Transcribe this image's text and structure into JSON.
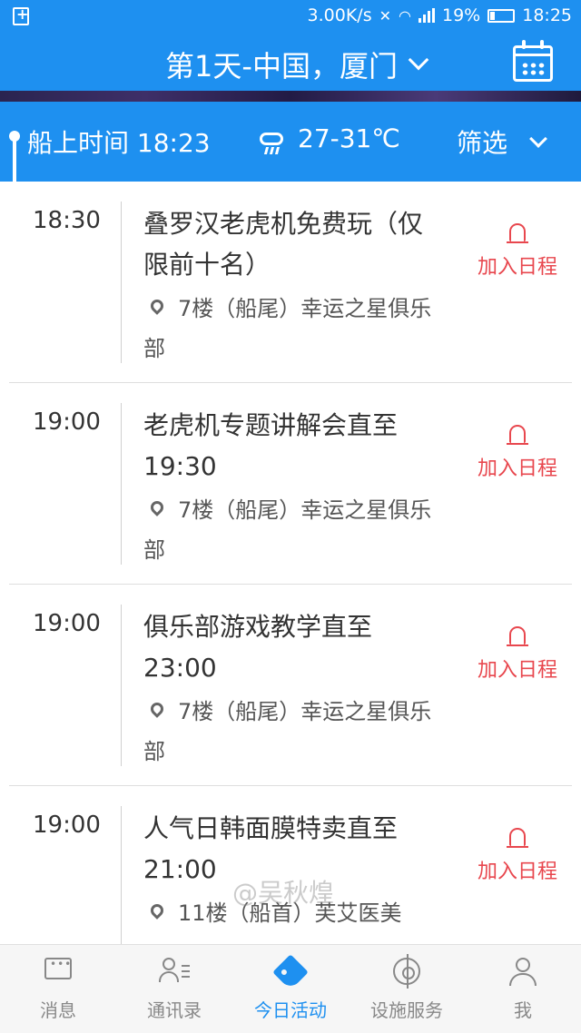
{
  "status": {
    "speed": "3.00K/s",
    "battery": "19%",
    "clock": "18:25"
  },
  "header": {
    "title": "第1天-中国，厦门"
  },
  "infobar": {
    "ship_time": "船上时间 18:23",
    "temperature": "27-31℃",
    "filter_label": "筛选"
  },
  "events": [
    {
      "time": "18:30",
      "title": "叠罗汉老虎机免费玩（仅限前十名）",
      "location": "7楼（船尾）幸运之星俱乐部",
      "action": "加入日程"
    },
    {
      "time": "19:00",
      "title": "老虎机专题讲解会直至19:30",
      "location": "7楼（船尾）幸运之星俱乐部",
      "action": "加入日程"
    },
    {
      "time": "19:00",
      "title": "俱乐部游戏教学直至23:00",
      "location": "7楼（船尾）幸运之星俱乐部",
      "action": "加入日程"
    },
    {
      "time": "19:00",
      "title": "人气日韩面膜特卖直至21:00",
      "location": "11楼（船首）芙艾医美",
      "action": "加入日程"
    }
  ],
  "watermark": "@吴秋煌",
  "tabs": [
    {
      "label": "消息",
      "icon": "message-icon"
    },
    {
      "label": "通讯录",
      "icon": "contacts-icon"
    },
    {
      "label": "今日活动",
      "icon": "tag-icon",
      "active": true
    },
    {
      "label": "设施服务",
      "icon": "helm-wheel-icon"
    },
    {
      "label": "我",
      "icon": "user-icon"
    }
  ],
  "colors": {
    "primary": "#1e90f0",
    "accent_red": "#e8474e"
  }
}
